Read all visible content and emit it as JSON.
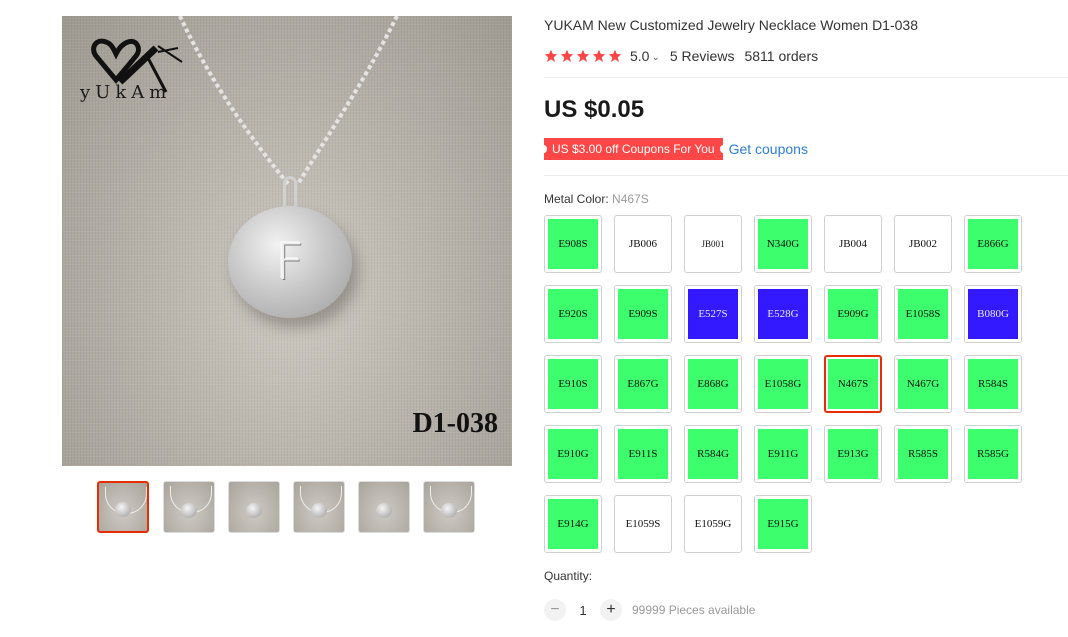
{
  "gallery": {
    "brand_name": "yUkAm",
    "model_code": "D1-038",
    "pendant_letter": "F",
    "thumbnail_count": 6
  },
  "product": {
    "title": "YUKAM New Customized Jewelry Necklace Women D1-038",
    "rating": "5.0",
    "reviews": "5 Reviews",
    "orders": "5811 orders",
    "price": "US $0.05",
    "coupon_tag": "US $3.00 off Coupons For You",
    "get_coupons": "Get coupons"
  },
  "metal_color": {
    "label": "Metal Color:",
    "selected": "N467S",
    "options": [
      {
        "code": "E908S",
        "color": "#3dff6e"
      },
      {
        "code": "JB006",
        "color": "#ffffff"
      },
      {
        "code": "JB001",
        "color": "#ffffff"
      },
      {
        "code": "N340G",
        "color": "#3dff6e"
      },
      {
        "code": "JB004",
        "color": "#ffffff"
      },
      {
        "code": "JB002",
        "color": "#ffffff"
      },
      {
        "code": "E866G",
        "color": "#3dff6e"
      },
      {
        "code": "E920S",
        "color": "#3dff6e"
      },
      {
        "code": "E909S",
        "color": "#3dff6e"
      },
      {
        "code": "E527S",
        "color": "#3219ff"
      },
      {
        "code": "E528G",
        "color": "#3219ff"
      },
      {
        "code": "E909G",
        "color": "#3dff6e"
      },
      {
        "code": "E1058S",
        "color": "#3dff6e"
      },
      {
        "code": "B080G",
        "color": "#3219ff"
      },
      {
        "code": "E910S",
        "color": "#3dff6e"
      },
      {
        "code": "E867G",
        "color": "#3dff6e"
      },
      {
        "code": "E868G",
        "color": "#3dff6e"
      },
      {
        "code": "E1058G",
        "color": "#3dff6e"
      },
      {
        "code": "N467S",
        "color": "#3dff6e"
      },
      {
        "code": "N467G",
        "color": "#3dff6e"
      },
      {
        "code": "R584S",
        "color": "#3dff6e"
      },
      {
        "code": "E910G",
        "color": "#3dff6e"
      },
      {
        "code": "E911S",
        "color": "#3dff6e"
      },
      {
        "code": "R584G",
        "color": "#3dff6e"
      },
      {
        "code": "E911G",
        "color": "#3dff6e"
      },
      {
        "code": "E913G",
        "color": "#3dff6e"
      },
      {
        "code": "R585S",
        "color": "#3dff6e"
      },
      {
        "code": "R585G",
        "color": "#3dff6e"
      },
      {
        "code": "E914G",
        "color": "#3dff6e"
      },
      {
        "code": "E1059S",
        "color": "#ffffff"
      },
      {
        "code": "E1059G",
        "color": "#ffffff"
      },
      {
        "code": "E915G",
        "color": "#3dff6e"
      }
    ]
  },
  "quantity": {
    "label": "Quantity:",
    "minus": "−",
    "value": "1",
    "plus": "+",
    "available": "99999 Pieces available"
  },
  "colors": {
    "accent_red": "#e62e04",
    "star": "#ff4747",
    "link_blue": "#2e7ed3"
  }
}
